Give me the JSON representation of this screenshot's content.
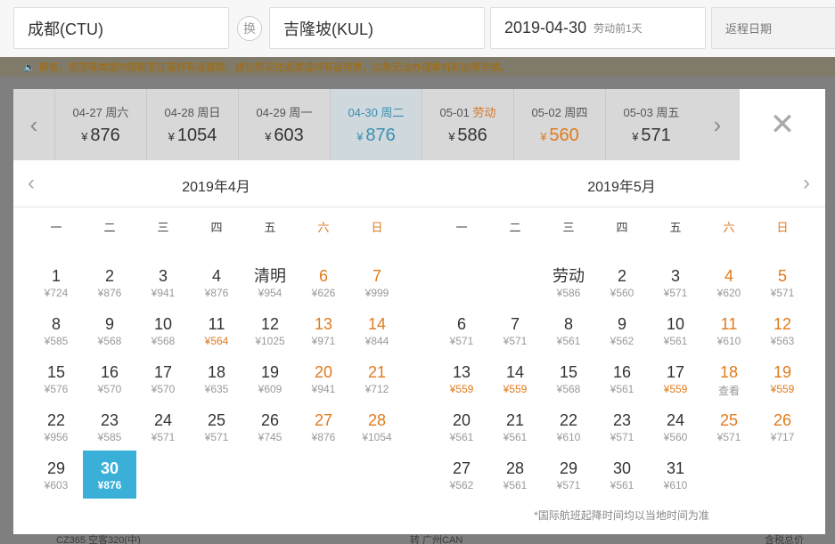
{
  "search": {
    "from": "成都(CTU)",
    "swap_label": "换",
    "to": "吉隆坡(KUL)",
    "date": "2019-04-30",
    "date_note": "劳动前1天",
    "return_placeholder": "返程日期"
  },
  "notice": {
    "icon": "speaker-icon",
    "text": "商务、旅游等类型的短期签证需持有返程票，建议购买往返票或持有返程票，以免无法办理乘机和出境手续。"
  },
  "strip": {
    "currency": "¥",
    "days": [
      {
        "date": "04-27",
        "weekday": "周六",
        "price": "876"
      },
      {
        "date": "04-28",
        "weekday": "周日",
        "price": "1054"
      },
      {
        "date": "04-29",
        "weekday": "周一",
        "price": "603"
      },
      {
        "date": "04-30",
        "weekday": "周二",
        "price": "876"
      },
      {
        "date": "05-01",
        "weekday": "劳动",
        "price": "586"
      },
      {
        "date": "05-02",
        "weekday": "周四",
        "price": "560"
      },
      {
        "date": "05-03",
        "weekday": "周五",
        "price": "571"
      }
    ]
  },
  "calendar": {
    "weekdays": [
      "一",
      "二",
      "三",
      "四",
      "五",
      "六",
      "日"
    ],
    "footnote": "*国际航班起降时间均以当地时间为准",
    "months": [
      {
        "title": "2019年4月",
        "cells": [
          {
            "d": "1",
            "p": "¥724"
          },
          {
            "d": "2",
            "p": "¥876"
          },
          {
            "d": "3",
            "p": "¥941"
          },
          {
            "d": "4",
            "p": "¥876"
          },
          {
            "d": "清明",
            "p": "¥954"
          },
          {
            "d": "6",
            "p": "¥626"
          },
          {
            "d": "7",
            "p": "¥999"
          },
          {
            "d": "8",
            "p": "¥585"
          },
          {
            "d": "9",
            "p": "¥568"
          },
          {
            "d": "10",
            "p": "¥568"
          },
          {
            "d": "11",
            "p": "¥564"
          },
          {
            "d": "12",
            "p": "¥1025"
          },
          {
            "d": "13",
            "p": "¥971"
          },
          {
            "d": "14",
            "p": "¥844"
          },
          {
            "d": "15",
            "p": "¥576"
          },
          {
            "d": "16",
            "p": "¥570"
          },
          {
            "d": "17",
            "p": "¥570"
          },
          {
            "d": "18",
            "p": "¥635"
          },
          {
            "d": "19",
            "p": "¥609"
          },
          {
            "d": "20",
            "p": "¥941"
          },
          {
            "d": "21",
            "p": "¥712"
          },
          {
            "d": "22",
            "p": "¥956"
          },
          {
            "d": "23",
            "p": "¥585"
          },
          {
            "d": "24",
            "p": "¥571"
          },
          {
            "d": "25",
            "p": "¥571"
          },
          {
            "d": "26",
            "p": "¥745"
          },
          {
            "d": "27",
            "p": "¥876"
          },
          {
            "d": "28",
            "p": "¥1054"
          },
          {
            "d": "29",
            "p": "¥603"
          },
          {
            "d": "30",
            "p": "¥876"
          }
        ]
      },
      {
        "title": "2019年5月",
        "cells": [
          {
            "d": "",
            "p": ""
          },
          {
            "d": "",
            "p": ""
          },
          {
            "d": "劳动",
            "p": "¥586"
          },
          {
            "d": "2",
            "p": "¥560"
          },
          {
            "d": "3",
            "p": "¥571"
          },
          {
            "d": "4",
            "p": "¥620"
          },
          {
            "d": "5",
            "p": "¥571"
          },
          {
            "d": "6",
            "p": "¥571"
          },
          {
            "d": "7",
            "p": "¥571"
          },
          {
            "d": "8",
            "p": "¥561"
          },
          {
            "d": "9",
            "p": "¥562"
          },
          {
            "d": "10",
            "p": "¥561"
          },
          {
            "d": "11",
            "p": "¥610"
          },
          {
            "d": "12",
            "p": "¥563"
          },
          {
            "d": "13",
            "p": "¥559"
          },
          {
            "d": "14",
            "p": "¥559"
          },
          {
            "d": "15",
            "p": "¥568"
          },
          {
            "d": "16",
            "p": "¥561"
          },
          {
            "d": "17",
            "p": "¥559"
          },
          {
            "d": "18",
            "p": "查看"
          },
          {
            "d": "19",
            "p": "¥559"
          },
          {
            "d": "20",
            "p": "¥561"
          },
          {
            "d": "21",
            "p": "¥561"
          },
          {
            "d": "22",
            "p": "¥610"
          },
          {
            "d": "23",
            "p": "¥571"
          },
          {
            "d": "24",
            "p": "¥560"
          },
          {
            "d": "25",
            "p": "¥571"
          },
          {
            "d": "26",
            "p": "¥717"
          },
          {
            "d": "27",
            "p": "¥562"
          },
          {
            "d": "28",
            "p": "¥561"
          },
          {
            "d": "29",
            "p": "¥571"
          },
          {
            "d": "30",
            "p": "¥561"
          },
          {
            "d": "31",
            "p": "¥610"
          }
        ]
      }
    ]
  },
  "background": {
    "flight_text": "CZ365 空客320(中)",
    "transfer_text": "转 广州CAN",
    "right_text": "含税总价"
  },
  "colors": {
    "accent": "#3ab0d8",
    "low_price": "#e07a1c",
    "weekend": "#e07a1c"
  }
}
